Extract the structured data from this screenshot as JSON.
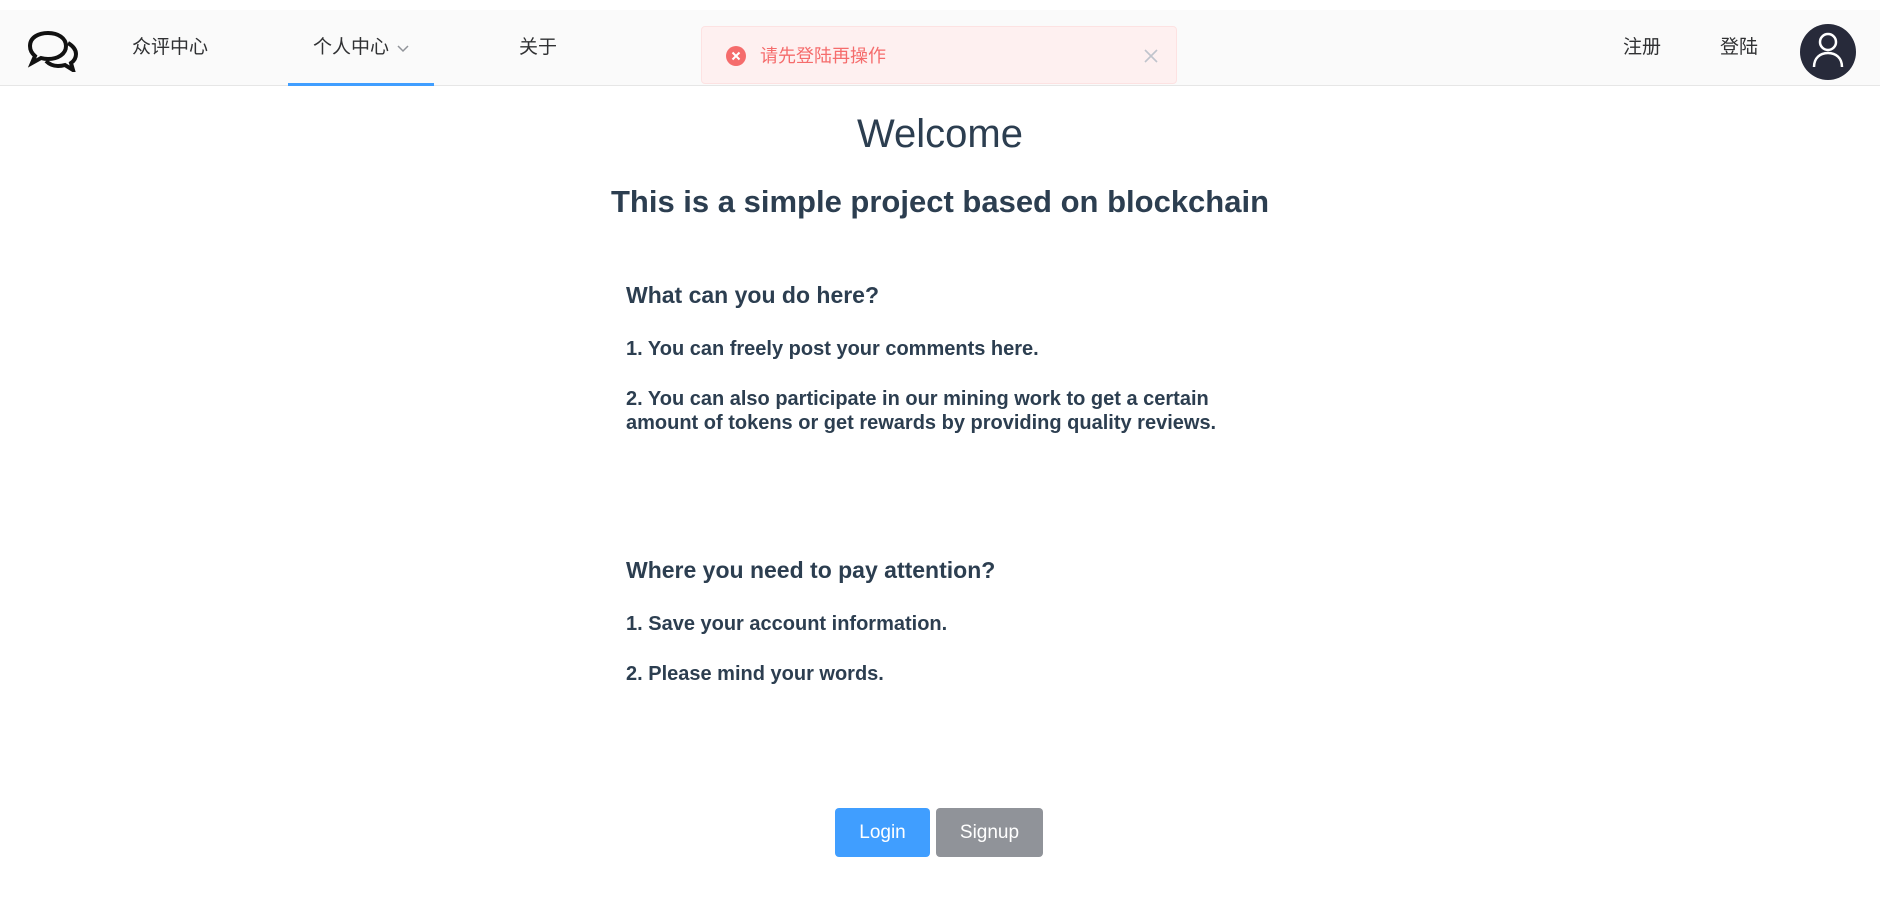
{
  "nav": {
    "items": [
      {
        "label": "众评中心"
      },
      {
        "label": "个人中心"
      },
      {
        "label": "关于"
      }
    ],
    "register_label": "注册",
    "login_label": "登陆",
    "active_index": 1,
    "accent": "#409eff"
  },
  "alert": {
    "message": "请先登陆再操作",
    "type": "error",
    "color": "#f56c6c"
  },
  "main": {
    "title": "Welcome",
    "subtitle": "This is a simple project based on blockchain",
    "section1": {
      "heading": "What can you do here?",
      "items": [
        "1. You can freely post your comments here.",
        "2. You can also participate in our mining work to get a certain amount of tokens or get rewards by providing quality reviews."
      ]
    },
    "section2": {
      "heading": "Where you need to pay attention?",
      "items": [
        "1. Save your account information.",
        "2. Please mind your words."
      ]
    }
  },
  "actions": {
    "login_label": "Login",
    "signup_label": "Signup"
  },
  "icons": {
    "logo": "chat-bubbles-icon",
    "avatar": "user-icon",
    "dropdown": "chevron-down-icon",
    "error": "error-circle-icon",
    "close": "close-icon"
  }
}
